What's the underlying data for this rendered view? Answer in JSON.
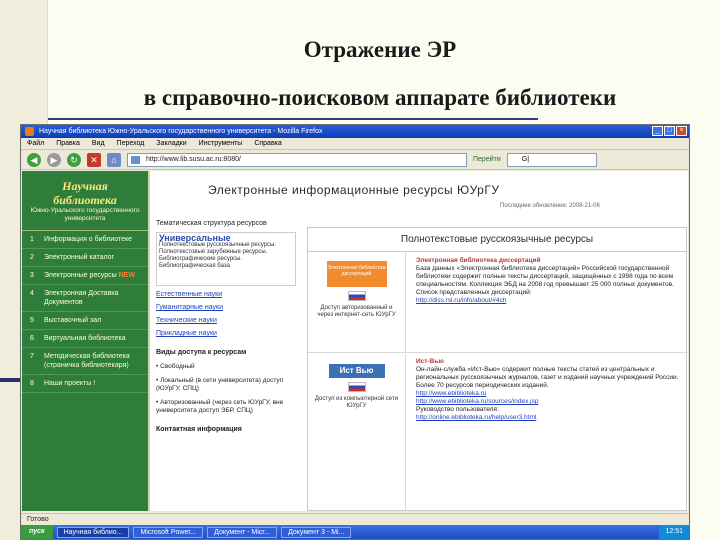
{
  "slide": {
    "title_line1": "Отражение ЭР",
    "title_line2": "в справочно-поисковом аппарате библиотеки"
  },
  "browser": {
    "window_title": "Научная библиотека Южно-Уральского государственного университета - Mozilla Firefox",
    "menu": [
      "Файл",
      "Правка",
      "Вид",
      "Переход",
      "Закладки",
      "Инструменты",
      "Справка"
    ],
    "address": "http://www.lib.susu.ac.ru:8080/",
    "go_label": "Перейти",
    "search_value": "G|",
    "status_text": "Готово"
  },
  "library_nav": {
    "logo_title_1": "Научная",
    "logo_title_2": "библиотека",
    "logo_subtitle": "Южно-Уральского государственного университета",
    "items": [
      {
        "num": "1",
        "label": "Информация о библиотеке"
      },
      {
        "num": "2",
        "label": "Электронный каталог"
      },
      {
        "num": "3",
        "label": "Электронные ресурсы",
        "badge": "NEW"
      },
      {
        "num": "4",
        "label": "Электронная Доставка Документов"
      },
      {
        "num": "5",
        "label": "Выставочный зал"
      },
      {
        "num": "6",
        "label": "Виртуальная библиотека"
      },
      {
        "num": "7",
        "label": "Методическая библиотека (страничка библиотекаря)"
      },
      {
        "num": "8",
        "label": "Наши проекты !"
      }
    ]
  },
  "page": {
    "title": "Электронные информационные ресурсы ЮУрГУ",
    "updated": "Последнее обновление: 2008-21-06"
  },
  "middle": {
    "structure_label": "Тематическая структура ресурсов",
    "univ_heading": "Универсальные",
    "univ_text": "Полнотекстовые русскоязычные ресурсы. Полнотекстовые зарубежные ресурсы. Библиографические ресурсы. Библиографическая база",
    "links": [
      "Естественные науки",
      "Гуманитарные науки",
      "Технические науки",
      "Прикладные науки"
    ],
    "access_heading": "Виды доступа к ресурсам",
    "access_items": [
      "Свободный",
      "Локальный (в сети университета) доступ (ЮУрГУ, СПЦ)",
      "Авторизованный (через сеть ЮУрГУ, вне университета доступ ЭБР, СПЦ)"
    ],
    "contact_heading": "Контактная информация"
  },
  "resources_table": {
    "header": "Полнотекстовые русскоязычные ресурсы",
    "rows": [
      {
        "logo_text": "Электронная библиотека диссертаций",
        "access_note": "Доступ авторизованный и через интернет-сеть ЮУрГУ",
        "title": "Электронная библиотека диссертаций",
        "description": "База данных «Электронная библиотека диссертаций» Российской государственной библиотеки содержит полные тексты диссертаций, защищённых с 1998 года по всем специальностям. Коллекция ЭБД на 2008 год превышает 25 000 полных документов.",
        "list_label": "Список представленных диссертаций:",
        "link": "http://diss.rsl.ru/info/about/#4ch"
      },
      {
        "logo_text": "Ист Вью",
        "access_note": "Доступ из компьютерной сети ЮУрГУ",
        "title": "Ист-Вью",
        "description": "Он-лайн-служба «Ист-Вью» содержит полные тексты статей из центральных и региональных русскоязычных журналов, газет и изданий научных учреждений России. Более 70 ресурсов периодических изданий.",
        "link1": "http://www.ebiblioteka.ru",
        "link2": "http://www.ebiblioteka.ru/sources/index.jsp",
        "guide_label": "Руководство пользователя:",
        "link3": "http://online.ebiblioteka.ru/help/user3.html"
      }
    ]
  },
  "taskbar": {
    "start": "пуск",
    "tasks": [
      "Научная библио...",
      "Microsoft Power...",
      "Документ - Micr...",
      "Документ 3 - Mi..."
    ],
    "clock": "12:51"
  }
}
